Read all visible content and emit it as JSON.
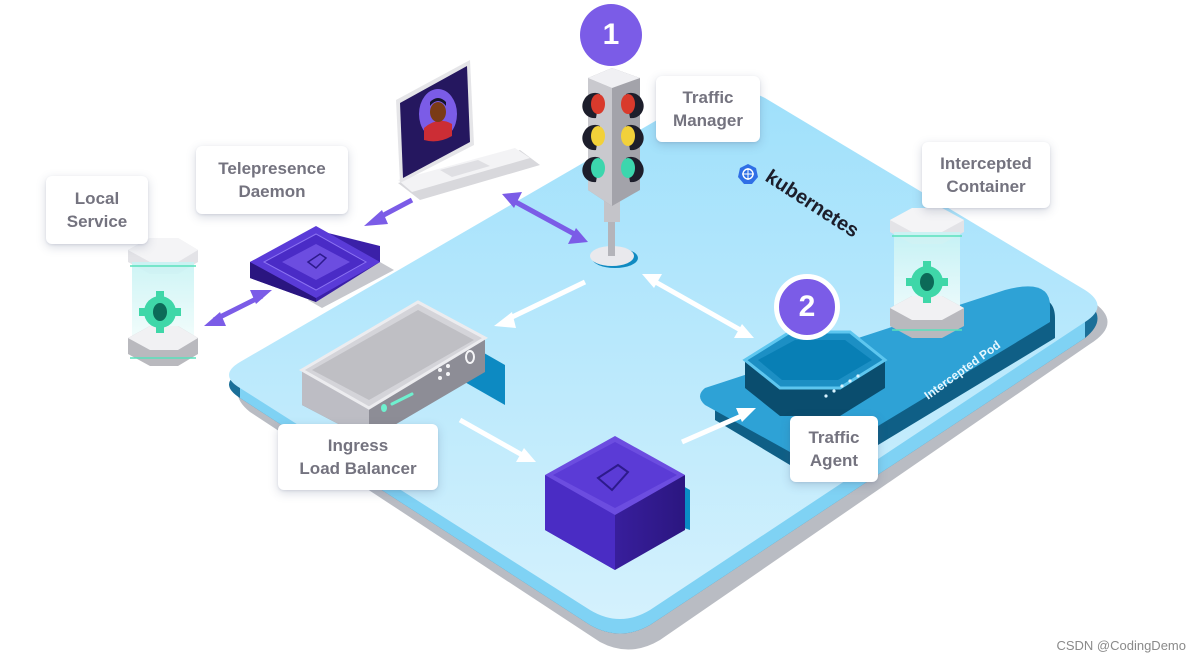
{
  "diagram": {
    "platform_label": "kubernetes",
    "pod_label": "Intercepted Pod",
    "labels": {
      "traffic_manager": [
        "Traffic",
        "Manager"
      ],
      "intercepted_container": [
        "Intercepted",
        "Container"
      ],
      "telepresence_daemon": [
        "Telepresence",
        "Daemon"
      ],
      "local_service": [
        "Local",
        "Service"
      ],
      "ingress_load_balancer": [
        "Ingress",
        "Load Balancer"
      ],
      "traffic_agent": [
        "Traffic",
        "Agent"
      ]
    },
    "badges": {
      "step1": "1",
      "step2": "2"
    },
    "colors": {
      "accent_purple": "#7b5ce7",
      "platform_blue": "#a6e3fb",
      "pod_blue": "#1f8fc6",
      "label_text": "#74737f",
      "gear_green": "#3fd7a8"
    }
  },
  "watermark": "CSDN @CodingDemo"
}
